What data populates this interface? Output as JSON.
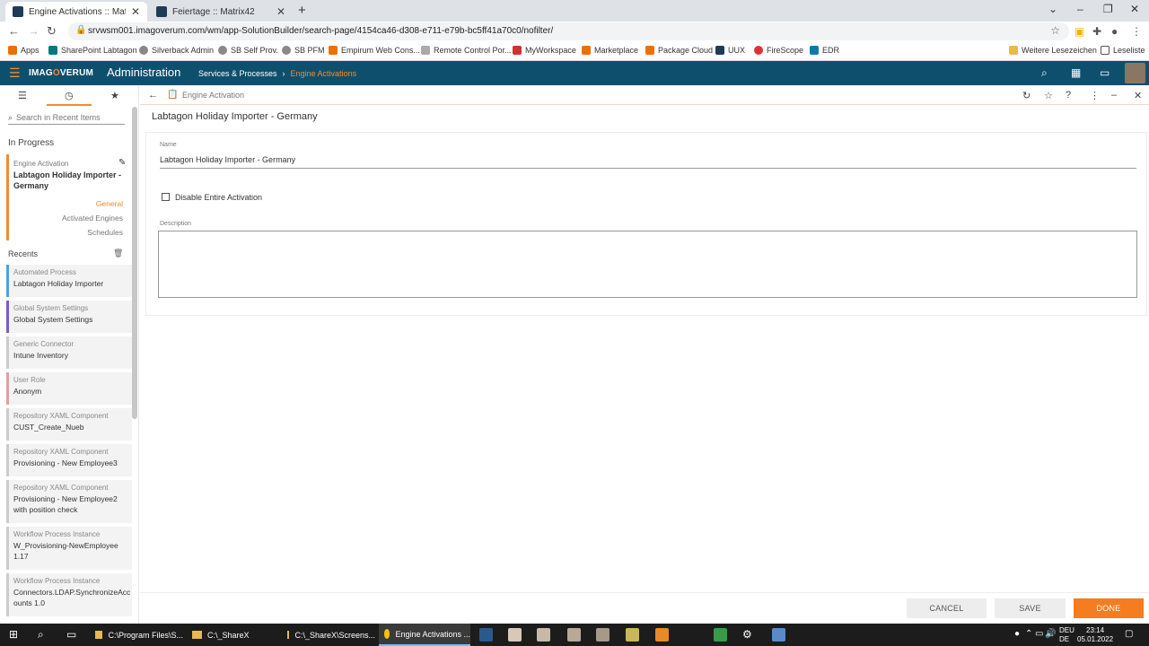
{
  "browser": {
    "tabs": [
      {
        "title": "Engine Activations :: Matrix42",
        "active": true
      },
      {
        "title": "Feiertage :: Matrix42",
        "active": false
      }
    ],
    "url": "srvwsm001.imagoverum.com/wm/app-SolutionBuilder/search-page/4154ca46-d308-e711-e79b-bc5ff41a70c0/nofilter/",
    "bookmarks": [
      "Apps",
      "SharePoint Labtagon",
      "Silverback Admin",
      "SB Self Prov.",
      "SB PFM",
      "Empirum Web Cons...",
      "Remote Control Por...",
      "MyWorkspace",
      "Marketplace",
      "Package Cloud",
      "UUX",
      "FireScope",
      "EDR"
    ],
    "other_bookmarks": "Weitere Lesezeichen",
    "reading_list": "Leseliste"
  },
  "app": {
    "logo_a": "IMAG",
    "logo_b": "O",
    "logo_c": "VERUM",
    "title": "Administration",
    "breadcrumb": [
      "Services & Processes",
      "Engine Activations"
    ]
  },
  "sidebar": {
    "search_placeholder": "Search in Recent Items",
    "in_progress_heading": "In Progress",
    "current": {
      "type": "Engine Activation",
      "name": "Labtagon Holiday Importer - Germany",
      "subnav": [
        "General",
        "Activated Engines",
        "Schedules"
      ]
    },
    "recents_heading": "Recents",
    "recents": [
      {
        "type": "Automated Process",
        "name": "Labtagon Holiday Importer",
        "color": "#4aa3df"
      },
      {
        "type": "Global System Settings",
        "name": "Global System Settings",
        "color": "#7b5cc4"
      },
      {
        "type": "Generic Connector",
        "name": "Intune Inventory",
        "color": "#cccccc"
      },
      {
        "type": "User Role",
        "name": "Anonym",
        "color": "#e0a0a0"
      },
      {
        "type": "Repository XAML Component",
        "name": "CUST_Create_Nueb",
        "color": "#cccccc"
      },
      {
        "type": "Repository XAML Component",
        "name": "Provisioning - New Employee3",
        "color": "#cccccc"
      },
      {
        "type": "Repository XAML Component",
        "name": "Provisioning - New Employee2 with position check",
        "color": "#cccccc"
      },
      {
        "type": "Workflow Process Instance",
        "name": "W_Provisioning-NewEmployee 1.17",
        "color": "#cccccc"
      },
      {
        "type": "Workflow Process Instance",
        "name": "Connectors.LDAP.SynchronizeAccounts 1.0",
        "color": "#cccccc"
      }
    ]
  },
  "main": {
    "toolbar_title": "Engine Activation",
    "page_title": "Labtagon Holiday Importer - Germany",
    "name_label": "Name",
    "name_value": "Labtagon Holiday Importer - Germany",
    "disable_label": "Disable Entire Activation",
    "description_label": "Description",
    "description_value": ""
  },
  "footer": {
    "cancel": "CANCEL",
    "save": "SAVE",
    "done": "DONE"
  },
  "taskbar": {
    "items": [
      "C:\\Program Files\\S...",
      "C:\\_ShareX",
      "C:\\_ShareX\\Screens...",
      "Engine Activations ..."
    ],
    "lang": [
      "DEU",
      "DE"
    ],
    "time": "23:14",
    "date": "05.01.2022"
  }
}
